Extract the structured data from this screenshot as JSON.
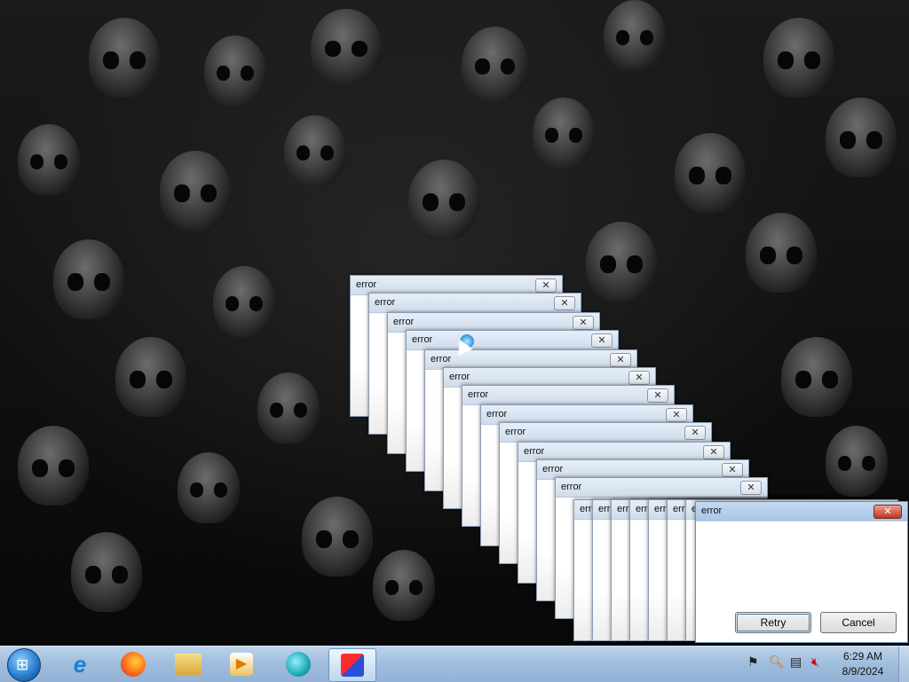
{
  "windows": {
    "error_title": "error",
    "cascade_titles": [
      "error",
      "error",
      "error",
      "error",
      "error",
      "error",
      "error",
      "error",
      "error",
      "error",
      "error",
      "error"
    ],
    "stacked_titles": [
      "err",
      "err",
      "err",
      "err",
      "err",
      "err",
      "err"
    ],
    "front": {
      "title": "error",
      "retry_label": "Retry",
      "cancel_label": "Cancel"
    }
  },
  "taskbar": {
    "items": [
      {
        "name": "internet-explorer",
        "icon": "internet-explorer-icon"
      },
      {
        "name": "firefox",
        "icon": "firefox-icon"
      },
      {
        "name": "file-explorer",
        "icon": "folder-icon"
      },
      {
        "name": "media-player",
        "icon": "media-player-icon"
      },
      {
        "name": "browser-app",
        "icon": "globe-icon"
      },
      {
        "name": "active-app",
        "icon": "shapes-app-icon"
      }
    ],
    "clock": {
      "time": "6:29 AM",
      "date": "8/9/2024"
    }
  },
  "colors": {
    "taskbar": "#9fbcdc",
    "close_red": "#c2321d"
  }
}
